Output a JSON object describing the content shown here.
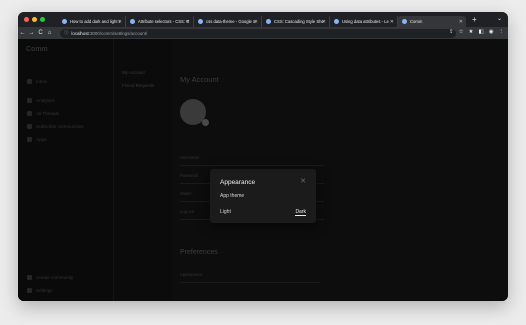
{
  "window": {
    "traffic_colors": [
      "#ff5f57",
      "#febc2e",
      "#28c840"
    ]
  },
  "tabs": [
    {
      "label": "How to add dark and light t",
      "active": false
    },
    {
      "label": "Attribute selectors - CSS: C",
      "active": false
    },
    {
      "label": "css data-theme - Google S",
      "active": false
    },
    {
      "label": "CSS: Cascading Style She",
      "active": false
    },
    {
      "label": "Using data attributes - Le",
      "active": false
    },
    {
      "label": "Comm",
      "active": true
    }
  ],
  "toolbar": {
    "back_icon": "←",
    "forward_icon": "→",
    "reload_icon": "C",
    "home_icon": "⌂",
    "url_host": "localhost",
    "url_path": ":3000/comm/settings/account/",
    "right_icons": [
      "⇪",
      "☆",
      "★",
      "◧",
      "◉",
      "⋮"
    ]
  },
  "sidebar": {
    "brand": "Comm",
    "items": [
      {
        "label": "Inbox"
      },
      {
        "label": "Analytics"
      },
      {
        "label": "All Threads"
      },
      {
        "label": "Subscribe communities"
      },
      {
        "label": "Apps"
      }
    ],
    "footer_items": [
      {
        "label": "Create community"
      },
      {
        "label": "Settings"
      }
    ]
  },
  "subnav": {
    "items": [
      {
        "label": "My Account"
      },
      {
        "label": "Friend Requests"
      }
    ]
  },
  "main": {
    "heading": "My Account",
    "fields": [
      {
        "label": "Username",
        "value": ""
      },
      {
        "label": "Password",
        "value": ""
      },
      {
        "label": "Wallet",
        "value": ""
      },
      {
        "label": "Log out",
        "value": ""
      }
    ],
    "preferences_heading": "Preferences",
    "preferences_item": "Appearance"
  },
  "modal": {
    "title": "Appearance",
    "close_icon": "✕",
    "subtitle": "App theme",
    "option_light": "Light",
    "option_dark": "Dark"
  }
}
